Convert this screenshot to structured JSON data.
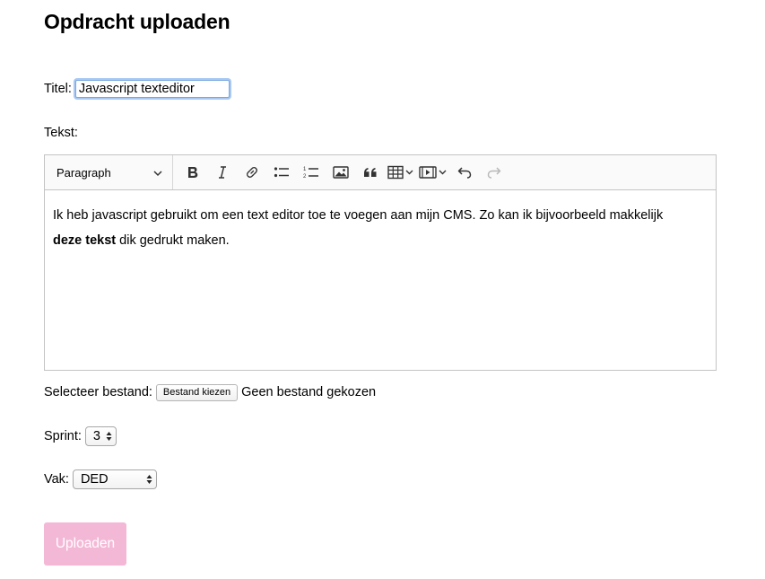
{
  "page": {
    "title": "Opdracht uploaden"
  },
  "form": {
    "title_label": "Titel:",
    "title_value": "Javascript texteditor",
    "text_label": "Tekst:",
    "file_label": "Selecteer bestand:",
    "file_button": "Bestand kiezen",
    "file_status": "Geen bestand gekozen",
    "sprint_label": "Sprint:",
    "sprint_value": "3",
    "vak_label": "Vak:",
    "vak_value": "DED",
    "upload_button": "Uploaden",
    "upload_color": "#f4b8d7"
  },
  "editor": {
    "heading_select": "Paragraph",
    "toolbar_icons": [
      "bold-icon",
      "italic-icon",
      "link-icon",
      "bulleted-list-icon",
      "numbered-list-icon",
      "image-icon",
      "blockquote-icon",
      "table-icon",
      "media-icon",
      "undo-icon",
      "redo-icon"
    ],
    "content": {
      "part1": "Ik heb javascript gebruikt om een text editor toe te voegen aan mijn CMS. Zo kan ik bijvoorbeeld makkelijk",
      "bold": "deze tekst",
      "part2": " dik gedrukt maken."
    }
  }
}
